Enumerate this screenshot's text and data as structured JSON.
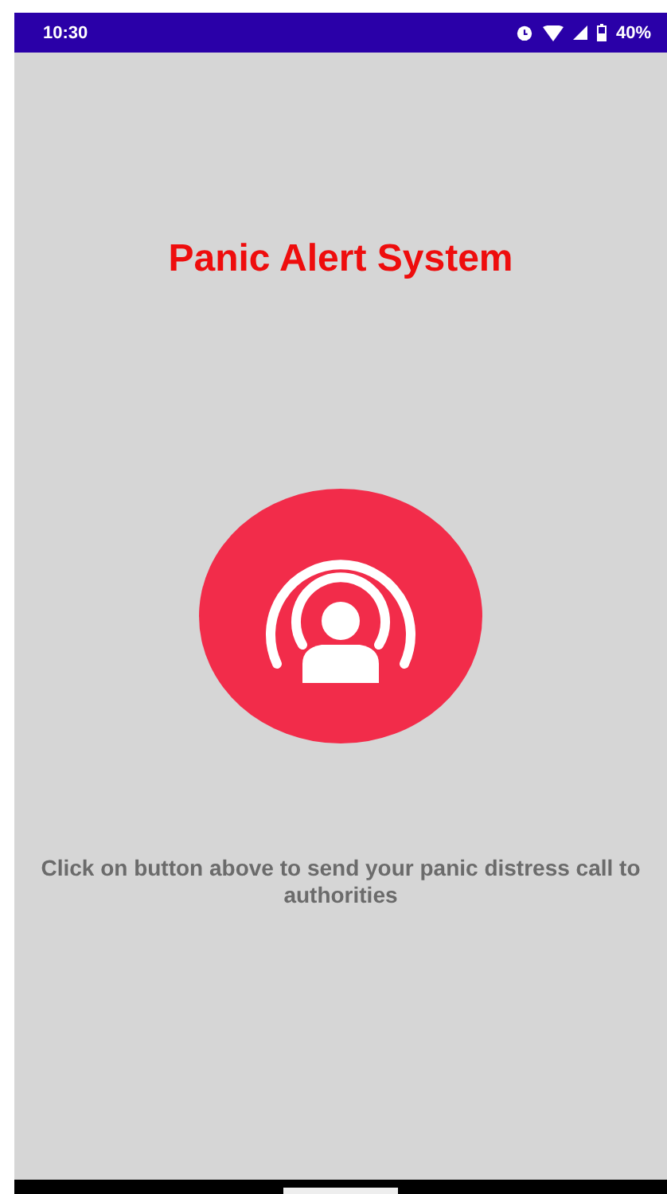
{
  "status_bar": {
    "time": "10:30",
    "battery": "40%"
  },
  "title": "Panic Alert System",
  "instruction": "Click on button above to send your panic distress call to authorities"
}
